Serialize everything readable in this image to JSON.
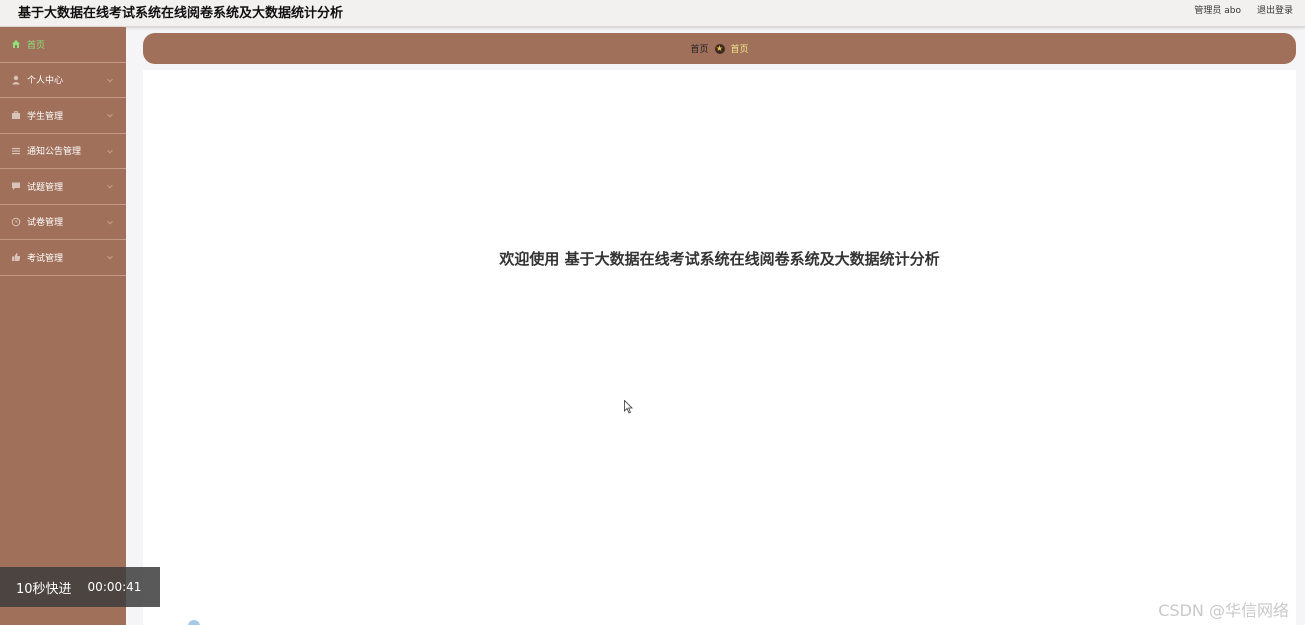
{
  "header": {
    "title": "基于大数据在线考试系统在线阅卷系统及大数据统计分析",
    "user_label": "管理员 abo",
    "logout_label": "退出登录"
  },
  "sidebar": {
    "items": [
      {
        "label": "首页",
        "icon": "home-icon",
        "active": true
      },
      {
        "label": "个人中心",
        "icon": "user-icon"
      },
      {
        "label": "学生管理",
        "icon": "briefcase-icon"
      },
      {
        "label": "通知公告管理",
        "icon": "list-icon"
      },
      {
        "label": "试题管理",
        "icon": "chat-icon"
      },
      {
        "label": "试卷管理",
        "icon": "clock-icon"
      },
      {
        "label": "考试管理",
        "icon": "thumbs-up-icon"
      }
    ]
  },
  "breadcrumb": {
    "home": "首页",
    "current": "首页"
  },
  "main": {
    "welcome": "欢迎使用 基于大数据在线考试系统在线阅卷系统及大数据统计分析"
  },
  "overlay": {
    "label": "10秒快进",
    "time": "00:00:41"
  },
  "watermark": "CSDN @华信网络",
  "colors": {
    "sidebar_bg": "#a0705a",
    "active_text": "#8fe07a",
    "header_bg": "#f3f0f0"
  }
}
